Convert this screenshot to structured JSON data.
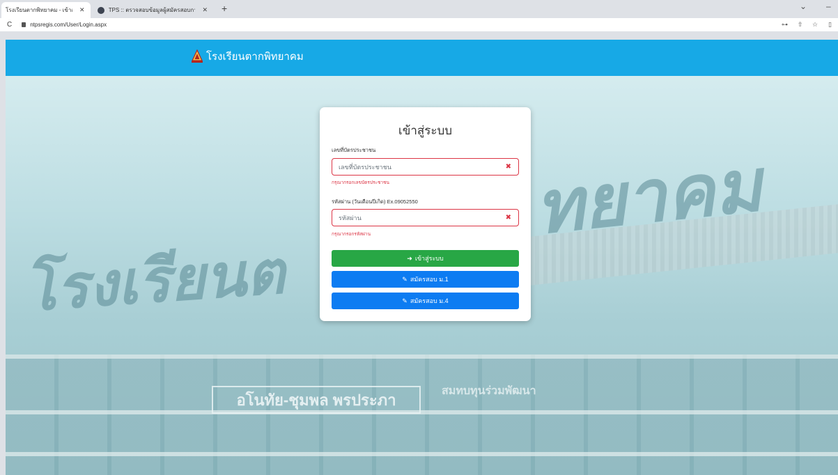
{
  "browser": {
    "tabs": [
      {
        "title": "โรงเรียนตากพิทยาคม - เข้าสู่ระบบ",
        "active": true
      },
      {
        "title": "TPS :: ตรวจสอบข้อมูลผู้สมัครสอบการ",
        "active": false
      }
    ],
    "url": "ntpsregis.com/User/Login.aspx"
  },
  "navbar": {
    "brand": "โรงเรียนตากพิทยาคม",
    "color": "#17a9e6"
  },
  "background": {
    "big_text_left": "โรงเรียนต",
    "big_text_right": "ทยาคม",
    "banner": "อโนทัย-ชุมพล พรประภา",
    "banner2": "สมทบทุนร่วมพัฒนา"
  },
  "login": {
    "title": "เข้าสู่ระบบ",
    "id_label": "เลขที่บัตรประชาชน",
    "id_placeholder": "เลขที่บัตรประชาชน",
    "id_error": "กรุณากรอกเลขบัตรประชาชน",
    "password_label": "รหัสผ่าน (วันเดือนปีเกิด) Ex.09052550",
    "password_placeholder": "รหัสผ่าน",
    "password_error": "กรุณากรอกรหัสผ่าน",
    "login_button": "เข้าสู่ระบบ",
    "apply_m1_button": "สมัครสอบ ม.1",
    "apply_m4_button": "สมัครสอบ ม.4",
    "colors": {
      "error": "#dc3545",
      "login": "#28a745",
      "apply": "#0d7cf2"
    }
  }
}
